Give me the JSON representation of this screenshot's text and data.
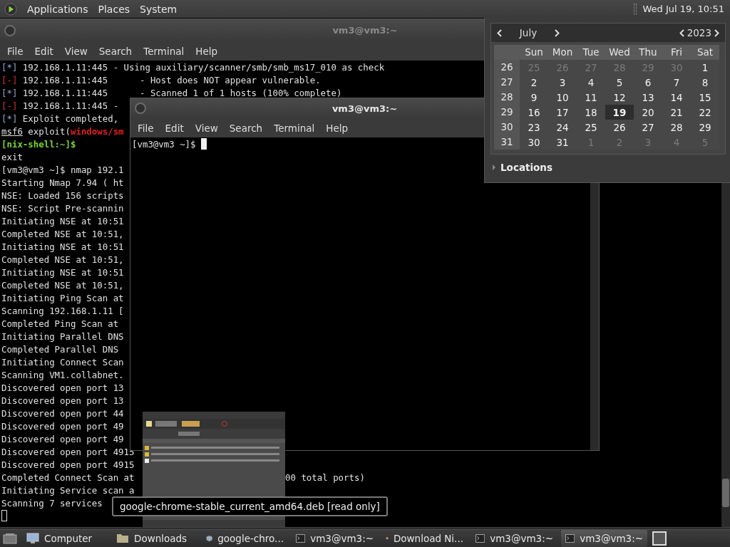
{
  "top_panel": {
    "menus": [
      "Applications",
      "Places",
      "System"
    ],
    "clock": "Wed Jul 19, 10:51"
  },
  "back_terminal": {
    "title": "vm3@vm3:~",
    "active": false,
    "menu": [
      "File",
      "Edit",
      "View",
      "Search",
      "Terminal",
      "Help"
    ],
    "lines": [
      {
        "segments": [
          {
            "text": "[*]",
            "kind": "info"
          },
          {
            "text": " 192.168.1.11:445 - Using auxiliary/scanner/smb/smb_ms17_010 as check",
            "kind": "plain"
          }
        ]
      },
      {
        "segments": [
          {
            "text": "[-]",
            "kind": "error"
          },
          {
            "text": " 192.168.1.11:445      - Host does NOT appear vulnerable.",
            "kind": "plain"
          }
        ]
      },
      {
        "segments": [
          {
            "text": "[*]",
            "kind": "info"
          },
          {
            "text": " 192.168.1.11:445      - Scanned 1 of 1 hosts (100% complete)",
            "kind": "plain"
          }
        ]
      },
      {
        "segments": [
          {
            "text": "[-]",
            "kind": "error"
          },
          {
            "text": " 192.168.1.11:445 -",
            "kind": "plain"
          }
        ]
      },
      {
        "segments": [
          {
            "text": "[*]",
            "kind": "info"
          },
          {
            "text": " Exploit completed,",
            "kind": "plain"
          }
        ]
      },
      {
        "segments": [
          {
            "text": "msf6",
            "kind": "underline"
          },
          {
            "text": " exploit(",
            "kind": "plain"
          },
          {
            "text": "windows/sm",
            "kind": "module"
          }
        ]
      },
      {
        "segments": [
          {
            "text": "[nix-shell:~]$",
            "kind": "shell"
          }
        ]
      },
      {
        "segments": [
          {
            "text": "exit",
            "kind": "plain"
          }
        ]
      },
      {
        "segments": [
          {
            "text": "[vm3@vm3 ~]$ nmap 192.1",
            "kind": "plain"
          }
        ]
      },
      {
        "segments": [
          {
            "text": "Starting Nmap 7.94 ( ht",
            "kind": "plain"
          }
        ]
      },
      {
        "segments": [
          {
            "text": "NSE: Loaded 156 scripts",
            "kind": "plain"
          }
        ]
      },
      {
        "segments": [
          {
            "text": "NSE: Script Pre-scannin",
            "kind": "plain"
          }
        ]
      },
      {
        "segments": [
          {
            "text": "Initiating NSE at 10:51",
            "kind": "plain"
          }
        ]
      },
      {
        "segments": [
          {
            "text": "Completed NSE at 10:51,",
            "kind": "plain"
          }
        ]
      },
      {
        "segments": [
          {
            "text": "Initiating NSE at 10:51",
            "kind": "plain"
          }
        ]
      },
      {
        "segments": [
          {
            "text": "Completed NSE at 10:51,",
            "kind": "plain"
          }
        ]
      },
      {
        "segments": [
          {
            "text": "Initiating NSE at 10:51",
            "kind": "plain"
          }
        ]
      },
      {
        "segments": [
          {
            "text": "Completed NSE at 10:51,",
            "kind": "plain"
          }
        ]
      },
      {
        "segments": [
          {
            "text": "Initiating Ping Scan at",
            "kind": "plain"
          }
        ]
      },
      {
        "segments": [
          {
            "text": "Scanning 192.168.1.11 [",
            "kind": "plain"
          }
        ]
      },
      {
        "segments": [
          {
            "text": "Completed Ping Scan at",
            "kind": "plain"
          }
        ]
      },
      {
        "segments": [
          {
            "text": "Initiating Parallel DNS",
            "kind": "plain"
          }
        ]
      },
      {
        "segments": [
          {
            "text": "Completed Parallel DNS",
            "kind": "plain"
          }
        ]
      },
      {
        "segments": [
          {
            "text": "Initiating Connect Scan",
            "kind": "plain"
          }
        ]
      },
      {
        "segments": [
          {
            "text": "Scanning VM1.collabnet.",
            "kind": "plain"
          }
        ]
      },
      {
        "segments": [
          {
            "text": "Discovered open port 13",
            "kind": "plain"
          }
        ]
      },
      {
        "segments": [
          {
            "text": "Discovered open port 13",
            "kind": "plain"
          }
        ]
      },
      {
        "segments": [
          {
            "text": "Discovered open port 44",
            "kind": "plain"
          }
        ]
      },
      {
        "segments": [
          {
            "text": "Discovered open port 49",
            "kind": "plain"
          }
        ]
      },
      {
        "segments": [
          {
            "text": "Discovered open port 49",
            "kind": "plain"
          }
        ]
      },
      {
        "segments": [
          {
            "text": "Discovered open port 4915",
            "kind": "plain"
          }
        ]
      },
      {
        "segments": [
          {
            "text": "Discovered open port 4915",
            "kind": "plain"
          }
        ]
      },
      {
        "segments": [
          {
            "text": "Completed Connect Scan at",
            "kind": "plain"
          }
        ],
        "tail": "00 total ports)"
      },
      {
        "segments": [
          {
            "text": "Initiating Service scan a",
            "kind": "plain"
          }
        ]
      },
      {
        "segments": [
          {
            "text": "Scanning 7 services",
            "kind": "plain"
          }
        ]
      }
    ]
  },
  "front_terminal": {
    "title": "vm3@vm3:~",
    "active": true,
    "menu": [
      "File",
      "Edit",
      "View",
      "Search",
      "Terminal",
      "Help"
    ],
    "prompt": "[vm3@vm3 ~]$"
  },
  "calendar": {
    "month": "July",
    "year": "2023",
    "weekdays": [
      "Sun",
      "Mon",
      "Tue",
      "Wed",
      "Thu",
      "Fri",
      "Sat"
    ],
    "weeks": [
      {
        "number": "26",
        "days": [
          {
            "day": "25",
            "outside": true,
            "selected": false
          },
          {
            "day": "26",
            "outside": true,
            "selected": false
          },
          {
            "day": "27",
            "outside": true,
            "selected": false
          },
          {
            "day": "28",
            "outside": true,
            "selected": false
          },
          {
            "day": "29",
            "outside": true,
            "selected": false
          },
          {
            "day": "30",
            "outside": true,
            "selected": false
          },
          {
            "day": "1",
            "outside": false,
            "selected": false
          }
        ]
      },
      {
        "number": "27",
        "days": [
          {
            "day": "2",
            "outside": false,
            "selected": false
          },
          {
            "day": "3",
            "outside": false,
            "selected": false
          },
          {
            "day": "4",
            "outside": false,
            "selected": false
          },
          {
            "day": "5",
            "outside": false,
            "selected": false
          },
          {
            "day": "6",
            "outside": false,
            "selected": false
          },
          {
            "day": "7",
            "outside": false,
            "selected": false
          },
          {
            "day": "8",
            "outside": false,
            "selected": false
          }
        ]
      },
      {
        "number": "28",
        "days": [
          {
            "day": "9",
            "outside": false,
            "selected": false
          },
          {
            "day": "10",
            "outside": false,
            "selected": false
          },
          {
            "day": "11",
            "outside": false,
            "selected": false
          },
          {
            "day": "12",
            "outside": false,
            "selected": false
          },
          {
            "day": "13",
            "outside": false,
            "selected": false
          },
          {
            "day": "14",
            "outside": false,
            "selected": false
          },
          {
            "day": "15",
            "outside": false,
            "selected": false
          }
        ]
      },
      {
        "number": "29",
        "days": [
          {
            "day": "16",
            "outside": false,
            "selected": false
          },
          {
            "day": "17",
            "outside": false,
            "selected": false
          },
          {
            "day": "18",
            "outside": false,
            "selected": false
          },
          {
            "day": "19",
            "outside": false,
            "selected": true
          },
          {
            "day": "20",
            "outside": false,
            "selected": false
          },
          {
            "day": "21",
            "outside": false,
            "selected": false
          },
          {
            "day": "22",
            "outside": false,
            "selected": false
          }
        ]
      },
      {
        "number": "30",
        "days": [
          {
            "day": "23",
            "outside": false,
            "selected": false
          },
          {
            "day": "24",
            "outside": false,
            "selected": false
          },
          {
            "day": "25",
            "outside": false,
            "selected": false
          },
          {
            "day": "26",
            "outside": false,
            "selected": false
          },
          {
            "day": "27",
            "outside": false,
            "selected": false
          },
          {
            "day": "28",
            "outside": false,
            "selected": false
          },
          {
            "day": "29",
            "outside": false,
            "selected": false
          }
        ]
      },
      {
        "number": "31",
        "days": [
          {
            "day": "30",
            "outside": false,
            "selected": false
          },
          {
            "day": "31",
            "outside": false,
            "selected": false
          },
          {
            "day": "1",
            "outside": true,
            "selected": false
          },
          {
            "day": "2",
            "outside": true,
            "selected": false
          },
          {
            "day": "3",
            "outside": true,
            "selected": false
          },
          {
            "day": "4",
            "outside": true,
            "selected": false
          },
          {
            "day": "5",
            "outside": true,
            "selected": false
          }
        ]
      }
    ],
    "locations": {
      "label": "Locations",
      "expanded": false
    }
  },
  "tooltip": {
    "text": "google-chrome-stable_current_amd64.deb [read only]"
  },
  "taskbar": {
    "items": [
      {
        "label": "Computer",
        "kind": "computer",
        "selected": false
      },
      {
        "label": "Downloads",
        "kind": "folder",
        "selected": false
      },
      {
        "label": "google-chro...",
        "kind": "package",
        "selected": false
      },
      {
        "label": "vm3@vm3:~",
        "kind": "terminal",
        "selected": false
      },
      {
        "label": "Download Ni...",
        "kind": "browser",
        "selected": false
      },
      {
        "label": "vm3@vm3:~",
        "kind": "terminal",
        "selected": false
      },
      {
        "label": "vm3@vm3:~",
        "kind": "terminal",
        "selected": true
      }
    ]
  }
}
